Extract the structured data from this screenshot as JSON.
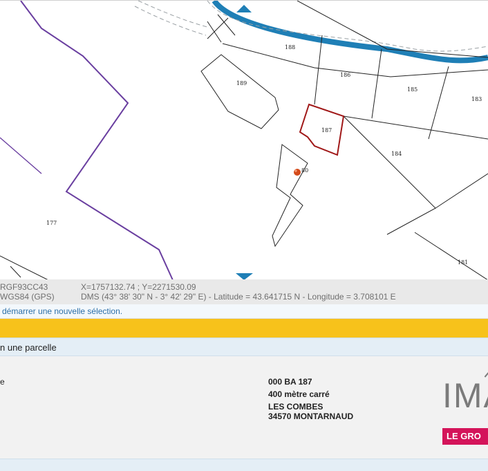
{
  "map": {
    "parcels": [
      "188",
      "189",
      "186",
      "185",
      "183",
      "187",
      "184",
      "80",
      "177",
      "181"
    ],
    "selected_parcel": "187"
  },
  "coordinates": {
    "row1_system": "RGF93CC43",
    "row1_value": "X=1757132.74 ; Y=2271530.09",
    "row2_system": "WGS84 (GPS)",
    "row2_value": "DMS (43° 38' 30\" N - 3° 42' 29\" E) - Latitude = 43.641715 N - Longitude = 3.708101 E"
  },
  "hint": "démarrer une nouvelle sélection.",
  "panel": {
    "title": "n une parcelle",
    "label_1": "e",
    "label_2": "",
    "reference": "000 BA 187",
    "area": "400 mètre carré",
    "locality": "LES COMBES",
    "address": "34570 MONTARNAUD"
  },
  "logo": {
    "letters": "IMA",
    "band": "LE GRO"
  },
  "colors": {
    "river": "#1f7fb6",
    "commune_border": "#6a3fa0",
    "selected": "#a01818",
    "marker": "#d44a1a",
    "yellow_bar": "#f7c21b",
    "logo_band": "#d4145a"
  }
}
